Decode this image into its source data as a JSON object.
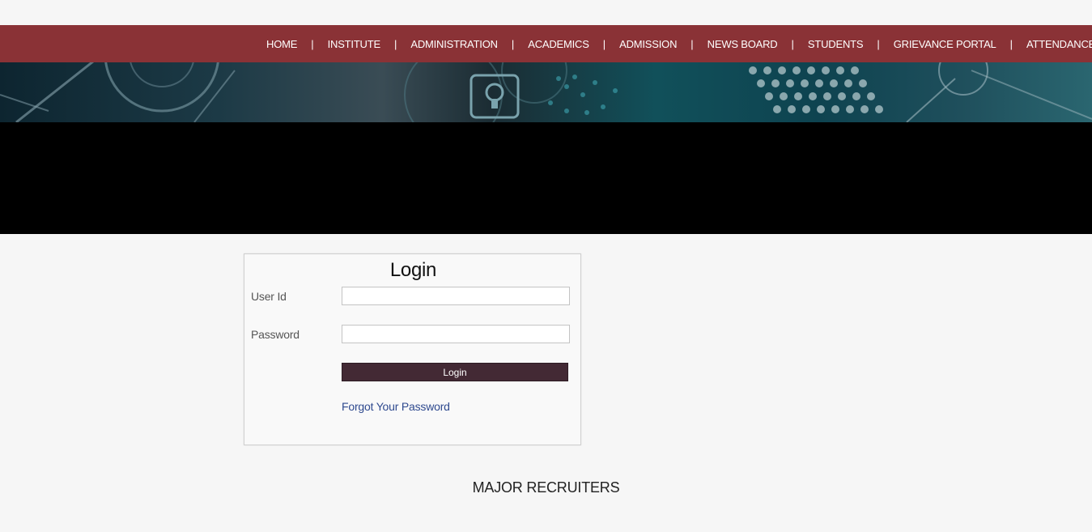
{
  "nav": {
    "items": [
      {
        "label": "HOME"
      },
      {
        "label": "INSTITUTE"
      },
      {
        "label": "ADMINISTRATION"
      },
      {
        "label": "ACADEMICS"
      },
      {
        "label": "ADMISSION"
      },
      {
        "label": "NEWS BOARD"
      },
      {
        "label": "STUDENTS"
      },
      {
        "label": "GRIEVANCE PORTAL"
      },
      {
        "label": "ATTENDANCE"
      }
    ],
    "separator": "|"
  },
  "login": {
    "title": "Login",
    "user_id_label": "User Id",
    "user_id_value": "",
    "password_label": "Password",
    "password_value": "",
    "button_label": "Login",
    "forgot_label": "Forgot Your Password"
  },
  "recruiters": {
    "heading": "MAJOR RECRUITERS"
  },
  "colors": {
    "navbar": "#8a3236",
    "login_button": "#432934",
    "link": "#2f4a8f",
    "band": "#000000"
  },
  "icons": {
    "banner_padlock": "padlock-icon"
  }
}
